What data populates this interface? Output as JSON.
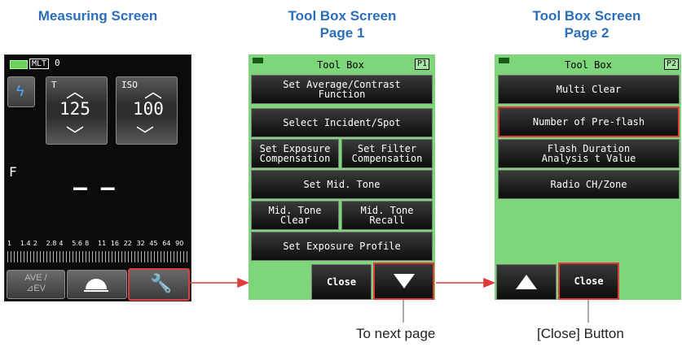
{
  "titles": {
    "measuring": "Measuring Screen",
    "toolbox1_line1": "Tool Box Screen",
    "toolbox1_line2": "Page 1",
    "toolbox2_line1": "Tool Box Screen",
    "toolbox2_line2": "Page 2"
  },
  "measuring": {
    "mode_badge": "MLT",
    "mode_count": "0",
    "t_label": "T",
    "iso_label": "ISO",
    "shutter_value": "125",
    "iso_value": "100",
    "f_label": "F",
    "aperture_value": "– –",
    "scale_ticks": [
      "1",
      "1.4",
      "2",
      "2.8",
      "4",
      "5.6",
      "8",
      "11",
      "16",
      "22",
      "32",
      "45",
      "64",
      "90"
    ],
    "ave_label_1": "AVE /",
    "ave_label_2": "⊿EV"
  },
  "toolbox1": {
    "header": "Tool Box",
    "page": "P1",
    "items": {
      "avg_contrast": "Set Average/Contrast\nFunction",
      "incident_spot": "Select Incident/Spot",
      "exposure_comp": "Set Exposure\nCompensation",
      "filter_comp": "Set Filter\nCompensation",
      "mid_tone": "Set Mid. Tone",
      "mid_tone_clear": "Mid. Tone\nClear",
      "mid_tone_recall": "Mid. Tone\nRecall",
      "exposure_profile": "Set Exposure Profile"
    },
    "close": "Close"
  },
  "toolbox2": {
    "header": "Tool Box",
    "page": "P2",
    "items": {
      "multi_clear": "Multi Clear",
      "pre_flash": "Number of Pre-flash",
      "flash_duration": "Flash Duration\nAnalysis t Value",
      "radio": "Radio CH/Zone"
    },
    "close": "Close"
  },
  "notes": {
    "next_page": "To next page",
    "close_button": "[Close] Button"
  },
  "colors": {
    "title_blue": "#2a6ebb",
    "screen_green": "#7dd67a",
    "highlight_red": "#e03a3a"
  }
}
